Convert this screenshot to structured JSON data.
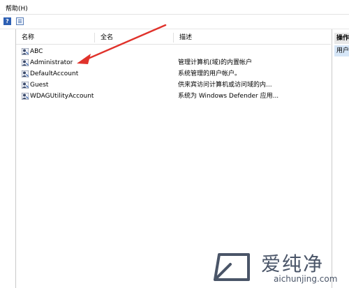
{
  "menubar": {
    "help": "帮助(H)"
  },
  "toolbar": {
    "help_icon": "help-icon",
    "view_icon": "view-icon"
  },
  "list": {
    "columns": {
      "name": "名称",
      "fullname": "全名",
      "description": "描述"
    },
    "rows": [
      {
        "name": "ABC",
        "fullname": "",
        "description": ""
      },
      {
        "name": "Administrator",
        "fullname": "",
        "description": "管理计算机(域)的内置帐户"
      },
      {
        "name": "DefaultAccount",
        "fullname": "",
        "description": "系统管理的用户帐户。"
      },
      {
        "name": "Guest",
        "fullname": "",
        "description": "供来宾访问计算机或访问域的内..."
      },
      {
        "name": "WDAGUtilityAccount",
        "fullname": "",
        "description": "系统为 Windows Defender 应用..."
      }
    ]
  },
  "actions": {
    "header": "操作",
    "item": "用户"
  },
  "watermark": {
    "cn": "爱纯净",
    "en": "aichunjing.com"
  },
  "colors": {
    "arrow": "#e0322b",
    "selection": "#d6e6f7",
    "watermark": "#4a5568"
  }
}
